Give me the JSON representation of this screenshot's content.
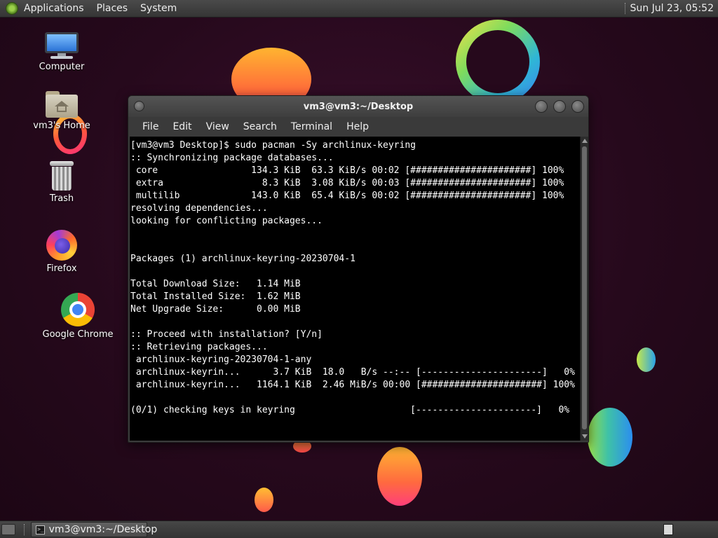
{
  "top_panel": {
    "menus": [
      "Applications",
      "Places",
      "System"
    ],
    "clock": "Sun Jul 23, 05:52"
  },
  "desktop": {
    "icons": [
      {
        "label": "Computer",
        "icon": "computer-icon"
      },
      {
        "label": "vm3's Home",
        "icon": "home-folder-icon"
      },
      {
        "label": "Trash",
        "icon": "trash-icon"
      },
      {
        "label": "Firefox",
        "icon": "firefox-icon"
      },
      {
        "label": "Google Chrome",
        "icon": "chrome-icon"
      }
    ]
  },
  "terminal": {
    "title": "vm3@vm3:~/Desktop",
    "menu": [
      "File",
      "Edit",
      "View",
      "Search",
      "Terminal",
      "Help"
    ],
    "lines": [
      "[vm3@vm3 Desktop]$ sudo pacman -Sy archlinux-keyring",
      ":: Synchronizing package databases...",
      " core                 134.3 KiB  63.3 KiB/s 00:02 [######################] 100%",
      " extra                  8.3 KiB  3.08 KiB/s 00:03 [######################] 100%",
      " multilib             143.0 KiB  65.4 KiB/s 00:02 [######################] 100%",
      "resolving dependencies...",
      "looking for conflicting packages...",
      "",
      "",
      "Packages (1) archlinux-keyring-20230704-1",
      "",
      "Total Download Size:   1.14 MiB",
      "Total Installed Size:  1.62 MiB",
      "Net Upgrade Size:      0.00 MiB",
      "",
      ":: Proceed with installation? [Y/n]",
      ":: Retrieving packages...",
      " archlinux-keyring-20230704-1-any",
      " archlinux-keyrin...      3.7 KiB  18.0   B/s --:-- [----------------------]   0%",
      " archlinux-keyrin...   1164.1 KiB  2.46 MiB/s 00:00 [######################] 100%",
      "",
      "(0/1) checking keys in keyring                     [----------------------]   0%"
    ]
  },
  "taskbar": {
    "window_button": "vm3@vm3:~/Desktop",
    "terminal_icon_text": ">_"
  },
  "colors": {
    "desktop_bg": "#26091c",
    "panel_bg": "#3e3e3e",
    "terminal_bg": "#000000",
    "terminal_fg": "#ffffff"
  }
}
